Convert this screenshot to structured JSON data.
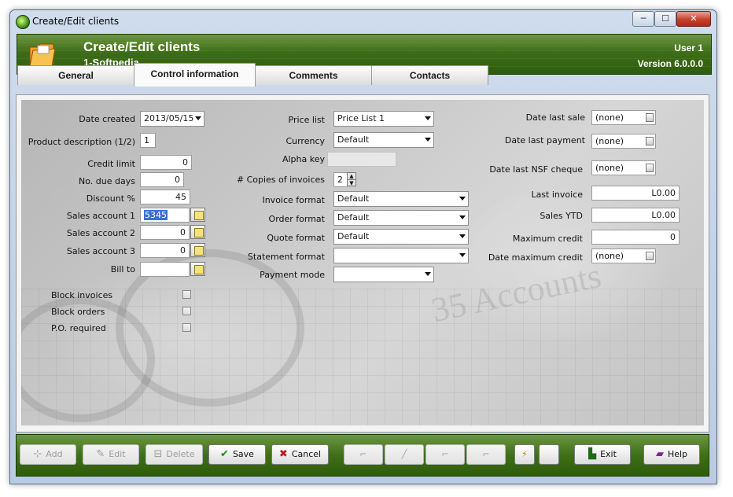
{
  "window": {
    "title": "Create/Edit clients",
    "controls": {
      "minimize": "─",
      "maximize": "☐",
      "close": "✕"
    }
  },
  "header": {
    "title": "Create/Edit clients",
    "subtitle": "1-Softpedia",
    "user": "User 1",
    "version": "Version 6.0.0.0"
  },
  "tabs": [
    {
      "label": "General"
    },
    {
      "label": "Control information",
      "active": true
    },
    {
      "label": "Comments"
    },
    {
      "label": "Contacts"
    }
  ],
  "left": {
    "date_created": {
      "label": "Date created",
      "value": "2013/05/15"
    },
    "product_description": {
      "label": "Product description (1/2)",
      "value": "1"
    },
    "credit_limit": {
      "label": "Credit limit",
      "value": "0"
    },
    "no_due_days": {
      "label": "No. due days",
      "value": "0"
    },
    "discount": {
      "label": "Discount %",
      "value": "45"
    },
    "sales_account_1": {
      "label": "Sales account 1",
      "value": "5345"
    },
    "sales_account_2": {
      "label": "Sales account 2",
      "value": "0"
    },
    "sales_account_3": {
      "label": "Sales account 3",
      "value": "0"
    },
    "bill_to": {
      "label": "Bill to",
      "value": ""
    },
    "block_invoices": {
      "label": "Block invoices",
      "checked": false
    },
    "block_orders": {
      "label": "Block orders",
      "checked": false
    },
    "po_required": {
      "label": "P.O. required",
      "checked": false
    }
  },
  "middle": {
    "price_list": {
      "label": "Price list",
      "value": "Price List 1"
    },
    "currency": {
      "label": "Currency",
      "value": "Default"
    },
    "alpha_key": {
      "label": "Alpha key",
      "value": ""
    },
    "copies_of_invoices": {
      "label": "# Copies of invoices",
      "value": "2"
    },
    "invoice_format": {
      "label": "Invoice format",
      "value": "Default"
    },
    "order_format": {
      "label": "Order format",
      "value": "Default"
    },
    "quote_format": {
      "label": "Quote format",
      "value": "Default"
    },
    "statement_format": {
      "label": "Statement format",
      "value": ""
    },
    "payment_mode": {
      "label": "Payment mode",
      "value": ""
    }
  },
  "right": {
    "date_last_sale": {
      "label": "Date last sale",
      "value": "(none)"
    },
    "date_last_payment": {
      "label": "Date last payment",
      "value": "(none)"
    },
    "date_last_nsf": {
      "label": "Date last NSF cheque",
      "value": "(none)"
    },
    "last_invoice": {
      "label": "Last invoice",
      "value": "L0.00"
    },
    "sales_ytd": {
      "label": "Sales YTD",
      "value": "L0.00"
    },
    "maximum_credit": {
      "label": "Maximum credit",
      "value": "0"
    },
    "date_maximum_credit": {
      "label": "Date maximum credit",
      "value": "(none)"
    }
  },
  "toolbar": {
    "add": "Add",
    "edit": "Edit",
    "delete": "Delete",
    "save": "Save",
    "cancel": "Cancel",
    "exit": "Exit",
    "help": "Help"
  },
  "colors": {
    "header_green": "#3e6d18",
    "selection_blue": "#3a6fd8",
    "save_check": "#1f8a1a",
    "cancel_x": "#c01818"
  }
}
